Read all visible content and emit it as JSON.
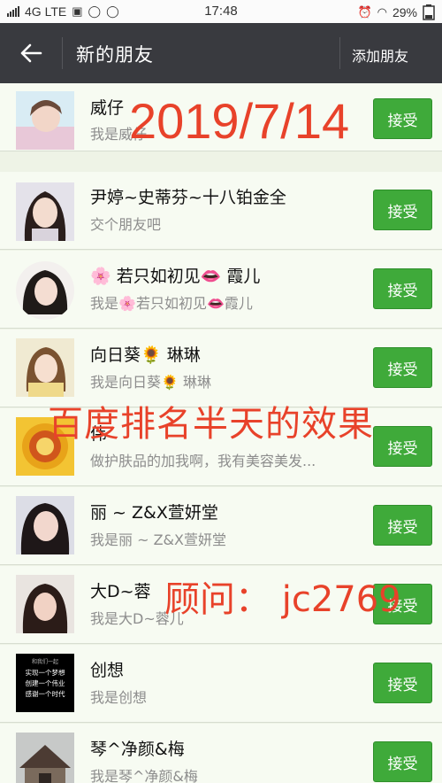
{
  "status_bar": {
    "network": "4G LTE",
    "time": "17:48",
    "battery": "29%"
  },
  "header": {
    "title": "新的朋友",
    "action": "添加朋友"
  },
  "requests": [
    {
      "nickname": "威仔",
      "message": "我是威仔",
      "accept_label": "接受"
    },
    {
      "nickname": "尹婷~史蒂芬~十八铂金全",
      "message": "交个朋友吧",
      "accept_label": "接受"
    },
    {
      "nickname_parts": [
        "🌸",
        " 若只如初见",
        "👄",
        " 霞儿"
      ],
      "message_parts": [
        "我是",
        "🌸",
        "若只如初见",
        "👄",
        "霞儿"
      ],
      "accept_label": "接受"
    },
    {
      "nickname_parts": [
        "向日葵",
        "🌻",
        " 琳琳"
      ],
      "message_parts": [
        "我是向日葵",
        "🌻",
        " 琳琳"
      ],
      "accept_label": "接受"
    },
    {
      "nickname": "伟",
      "message": "做护肤品的加我啊，我有美容美发...",
      "accept_label": "接受"
    },
    {
      "nickname": "丽 ~ Z&X萱妍堂",
      "message": "我是丽 ~ Z&X萱妍堂",
      "accept_label": "接受"
    },
    {
      "nickname": "大D~蓉",
      "message": "我是大D~蓉儿",
      "accept_label": "接受"
    },
    {
      "nickname": "创想",
      "message": "我是创想",
      "accept_label": "接受",
      "avatar_text": [
        "和我们一起",
        "实现一个梦想",
        "创建一个伟业",
        "感谢一个时代"
      ]
    },
    {
      "nickname": "琴^净颜&梅",
      "message": "我是琴^净颜&梅",
      "accept_label": "接受"
    }
  ],
  "overlays": {
    "date": "2019/7/14",
    "ranking": "百度排名半天的效果",
    "contact": "顾问：  jc2769"
  }
}
